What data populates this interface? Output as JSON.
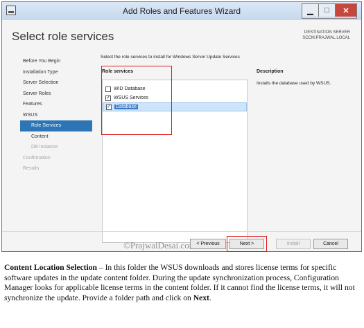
{
  "window": {
    "title": "Add Roles and Features Wizard",
    "minimize": "▁",
    "maximize": "□",
    "close": "✕"
  },
  "page": {
    "title": "Select role services",
    "destination_label": "DESTINATION SERVER",
    "destination_server": "SCCM.PRAJWAL.LOCAL",
    "instruction": "Select the role services to install for Windows Server Update Services"
  },
  "nav": {
    "items": [
      {
        "label": "Before You Begin",
        "state": "normal"
      },
      {
        "label": "Installation Type",
        "state": "normal"
      },
      {
        "label": "Server Selection",
        "state": "normal"
      },
      {
        "label": "Server Roles",
        "state": "normal"
      },
      {
        "label": "Features",
        "state": "normal"
      },
      {
        "label": "WSUS",
        "state": "normal"
      },
      {
        "label": "Role Services",
        "state": "active"
      },
      {
        "label": "Content",
        "state": "normal"
      },
      {
        "label": "DB Instance",
        "state": "disabled"
      },
      {
        "label": "Confirmation",
        "state": "disabled"
      },
      {
        "label": "Results",
        "state": "disabled"
      }
    ]
  },
  "role_services": {
    "header": "Role services",
    "items": [
      {
        "label": "WID Database",
        "checked": false,
        "selected": false
      },
      {
        "label": "WSUS Services",
        "checked": true,
        "selected": false
      },
      {
        "label": "Database",
        "checked": true,
        "selected": true
      }
    ]
  },
  "description": {
    "header": "Description",
    "text": "Installs the database used by WSUS."
  },
  "buttons": {
    "previous": "< Previous",
    "next": "Next >",
    "install": "Install",
    "cancel": "Cancel"
  },
  "watermark": "©PrajwalDesai.com",
  "caption": {
    "heading": "Content Location Selection",
    "dash": " – ",
    "body": "In this folder the WSUS downloads and stores license terms for specific software updates in the update content folder. During the update synchronization process,  Configuration Manager looks for applicable license terms in the content folder. If it cannot find the license terms, it will not synchronize the update. Provide a folder path and click on ",
    "emphasis": "Next",
    "end": "."
  },
  "colors": {
    "accent": "#2d75b4",
    "highlight_red": "#dd1c1c",
    "selection": "#cde4fb"
  }
}
